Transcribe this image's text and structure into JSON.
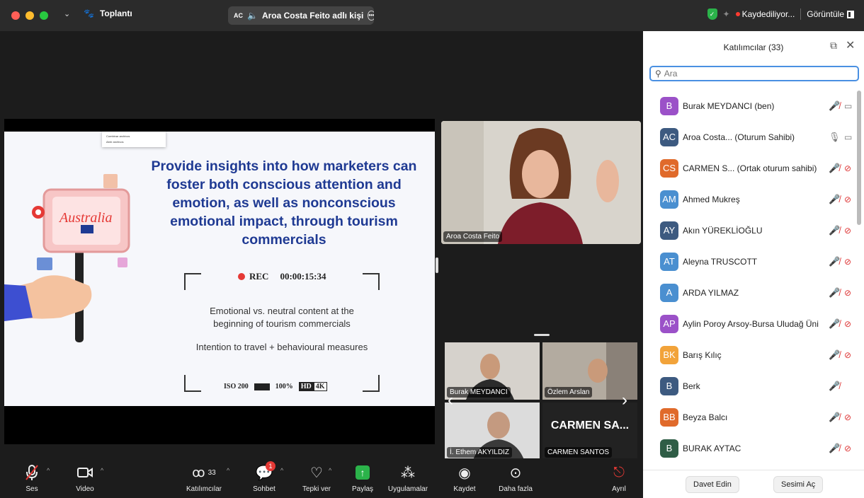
{
  "window": {
    "app_name": "Toplantı",
    "active_speaker_badge": "AC",
    "active_speaker_text": "Aroa Costa Feito adlı kişi",
    "recording_status": "Kaydediliyor...",
    "view_label": "Görüntüle"
  },
  "slide": {
    "headline": "Provide insights into how marketers can foster both conscious attention and emotion, as well as nonconscious emotional impact, through tourism commercials",
    "menu_items": [
      "Combinar archivos",
      "Abrir archivos"
    ],
    "rec_label": "REC",
    "rec_time": "00:00:15:34",
    "line1": "Emotional vs. neutral content at the beginning of tourism commercials",
    "line2": "Intention to travel + behavioural measures",
    "iso": "ISO 200",
    "battery": "100%",
    "hd": "HD",
    "res": "4K",
    "sign_text": "Australia"
  },
  "speaker": {
    "name": "Aroa Costa Feito"
  },
  "gallery": [
    {
      "name": "Burak MEYDANCI"
    },
    {
      "name": "Özlem Arslan"
    },
    {
      "name": "İ. Ethem AKYILDIZ"
    },
    {
      "name": "CARMEN SANTOS",
      "big": "CARMEN SA..."
    }
  ],
  "toolbar": {
    "audio": "Ses",
    "video": "Video",
    "participants": "Katılımcılar",
    "participants_count": "33",
    "chat": "Sohbet",
    "chat_badge": "1",
    "react": "Tepki ver",
    "share": "Paylaş",
    "apps": "Uygulamalar",
    "record": "Kaydet",
    "more": "Daha fazla",
    "leave": "Ayrıl"
  },
  "panel": {
    "title": "Katılımcılar (33)",
    "search_placeholder": "Ara",
    "participants": [
      {
        "initials": "B",
        "name": "Burak MEYDANCI (ben)",
        "color": "#9b51c8"
      },
      {
        "initials": "AC",
        "name": "Aroa Costa...  (Oturum Sahibi)",
        "color": "#3d5a80"
      },
      {
        "initials": "CS",
        "name": "CARMEN S...  (Ortak oturum sahibi)",
        "color": "#e06a2b"
      },
      {
        "initials": "AM",
        "name": "Ahmed Mukreş",
        "color": "#4a8fd0"
      },
      {
        "initials": "AY",
        "name": "Akın YÜREKLİOĞLU",
        "color": "#3d5a80"
      },
      {
        "initials": "AT",
        "name": "Aleyna TRUSCOTT",
        "color": "#4a8fd0"
      },
      {
        "initials": "A",
        "name": "ARDA YILMAZ",
        "color": "#4a8fd0"
      },
      {
        "initials": "AP",
        "name": "Aylin Poroy Arsoy-Bursa Uludağ Üni",
        "color": "#9b51c8"
      },
      {
        "initials": "BK",
        "name": "Barış Kılıç",
        "color": "#f2a33a"
      },
      {
        "initials": "B",
        "name": "Berk",
        "color": "#3d5a80"
      },
      {
        "initials": "BB",
        "name": "Beyza Balcı",
        "color": "#e06a2b"
      },
      {
        "initials": "B",
        "name": "BURAK AYTAC",
        "color": "#2f5d46"
      }
    ],
    "invite": "Davet Edin",
    "unmute": "Sesimi Aç"
  }
}
